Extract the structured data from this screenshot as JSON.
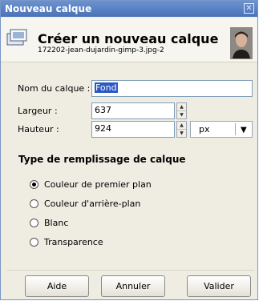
{
  "window": {
    "title": "Nouveau calque",
    "close_glyph": "✕"
  },
  "header": {
    "title": "Créer un nouveau calque",
    "subtitle": "172202-jean-dujardin-gimp-3.jpg-2",
    "icon": "new-layer-icon",
    "thumbnail": "image-thumbnail"
  },
  "form": {
    "name_label": "Nom du calque :",
    "name_value": "Fond",
    "width_label": "Largeur :",
    "width_value": "637",
    "height_label": "Hauteur :",
    "height_value": "924",
    "unit_value": "px"
  },
  "fill": {
    "section_title": "Type de remplissage de calque",
    "options": [
      {
        "label": "Couleur de premier plan",
        "selected": true
      },
      {
        "label": "Couleur d'arrière-plan",
        "selected": false
      },
      {
        "label": "Blanc",
        "selected": false
      },
      {
        "label": "Transparence",
        "selected": false
      }
    ]
  },
  "buttons": {
    "help": "Aide",
    "cancel": "Annuler",
    "ok": "Valider"
  }
}
